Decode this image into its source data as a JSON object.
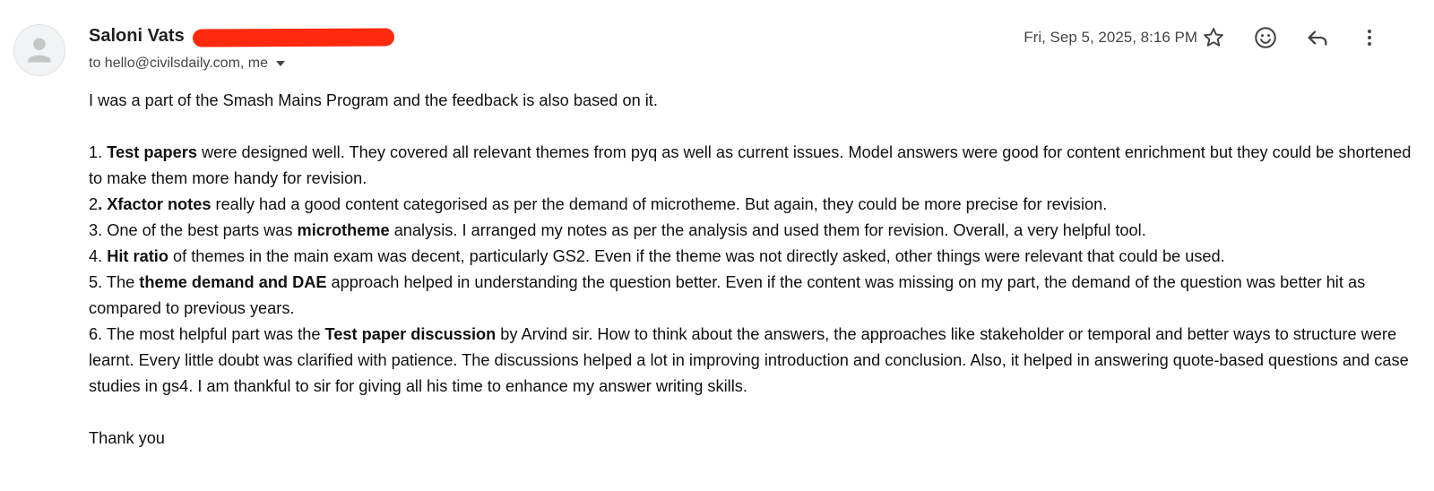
{
  "header": {
    "sender_name": "Saloni Vats",
    "recipients": "to hello@civilsdaily.com, me",
    "date": "Fri, Sep 5, 2025, 8:16 PM",
    "icons": [
      "person-icon",
      "star-icon",
      "emoji-icon",
      "reply-icon",
      "more-vert-icon"
    ],
    "redaction_color": "#ff2a0e"
  },
  "body": {
    "intro": "I was a part of the Smash Mains Program and the feedback is also based on it.",
    "items": [
      {
        "prefix": "1.  ",
        "bold": "Test papers",
        "rest": " were designed well. They covered all  relevant themes from pyq as well as current issues. Model answers were good for content enrichment but they could be shortened to make them more handy for revision."
      },
      {
        "prefix": "2",
        "bold": ". Xfactor notes",
        "rest": " really had a good content categorised as per the demand of microtheme. But again, they could be more precise for revision."
      },
      {
        "prefix": "3. One of the best parts was ",
        "bold": "microtheme",
        "rest": " analysis. I arranged my notes as per the analysis and used them for revision. Overall, a very helpful tool."
      },
      {
        "prefix": "4. ",
        "bold": "Hit ratio",
        "rest": " of themes in the main exam was decent, particularly GS2. Even if the theme was not directly asked, other things were relevant that could be used."
      },
      {
        "prefix": "5. The ",
        "bold": "theme demand and DAE",
        "rest": " approach helped in understanding the question better. Even if the content was missing on my part, the demand of the question was better hit as compared to previous years."
      },
      {
        "prefix": "6. The most helpful part was the ",
        "bold": "Test paper discussion",
        "rest": " by Arvind sir. How to think about the answers, the approaches like stakeholder or temporal and better ways to structure were learnt. Every little doubt was clarified with patience. The discussions helped a lot in improving introduction and conclusion. Also, it helped in answering quote-based questions and case studies in gs4.  I am thankful to  sir for giving all his time to enhance my answer writing skills."
      }
    ],
    "closing": "Thank you"
  }
}
